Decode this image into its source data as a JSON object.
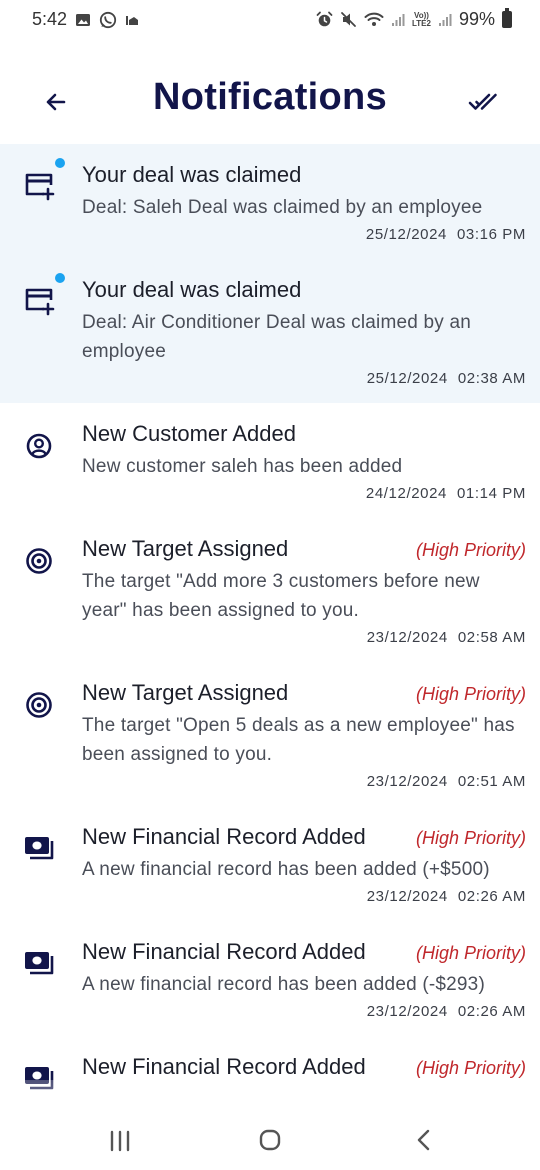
{
  "status_bar": {
    "time": "5:42",
    "left_icons": [
      "gallery-icon",
      "whatsapp-icon",
      "notification-icon"
    ],
    "right_icons": [
      "alarm-icon",
      "mute-icon",
      "wifi-icon",
      "signal-icon",
      "volte-icon",
      "signal-icon"
    ],
    "lte_top": "Vo))",
    "lte_bottom": "LTE2",
    "battery": "99%"
  },
  "header": {
    "title": "Notifications",
    "back_icon": "arrow-left-icon",
    "mark_all_icon": "double-check-icon"
  },
  "colors": {
    "title": "#12154a",
    "unread_bg": "#f0f6fb",
    "unread_dot": "#1ba3f0",
    "priority": "#c0282c"
  },
  "notifications": [
    {
      "title": "Your deal was claimed",
      "body": "Deal: Saleh Deal was claimed by an employee",
      "date": "25/12/2024",
      "time": "03:16 PM",
      "icon": "card-plus-icon",
      "unread": true,
      "priority": ""
    },
    {
      "title": "Your deal was claimed",
      "body": "Deal: Air Conditioner Deal was claimed by an employee",
      "date": "25/12/2024",
      "time": "02:38 AM",
      "icon": "card-plus-icon",
      "unread": true,
      "priority": ""
    },
    {
      "title": "New Customer Added",
      "body": "New customer saleh has been added",
      "date": "24/12/2024",
      "time": "01:14 PM",
      "icon": "user-circle-icon",
      "unread": false,
      "priority": ""
    },
    {
      "title": "New Target Assigned",
      "body": "The target \"Add more 3 customers before new year\" has been assigned to you.",
      "date": "23/12/2024",
      "time": "02:58 AM",
      "icon": "target-icon",
      "unread": false,
      "priority": "(High Priority)"
    },
    {
      "title": "New Target Assigned",
      "body": "The target \"Open 5 deals as a new employee\" has been assigned to you.",
      "date": "23/12/2024",
      "time": "02:51 AM",
      "icon": "target-icon",
      "unread": false,
      "priority": "(High Priority)"
    },
    {
      "title": "New Financial Record Added",
      "body": "A new financial record has been added (+$500)",
      "date": "23/12/2024",
      "time": "02:26 AM",
      "icon": "money-icon",
      "unread": false,
      "priority": "(High Priority)"
    },
    {
      "title": "New Financial Record Added",
      "body": "A new financial record has been added (-$293)",
      "date": "23/12/2024",
      "time": "02:26 AM",
      "icon": "money-icon",
      "unread": false,
      "priority": "(High Priority)"
    },
    {
      "title": "New Financial Record Added",
      "body": "",
      "date": "",
      "time": "",
      "icon": "money-icon",
      "unread": false,
      "priority": "(High Priority)"
    }
  ],
  "nav_bar": {
    "recents_icon": "recents-icon",
    "home_icon": "home-icon",
    "back_icon": "back-chevron-icon"
  }
}
